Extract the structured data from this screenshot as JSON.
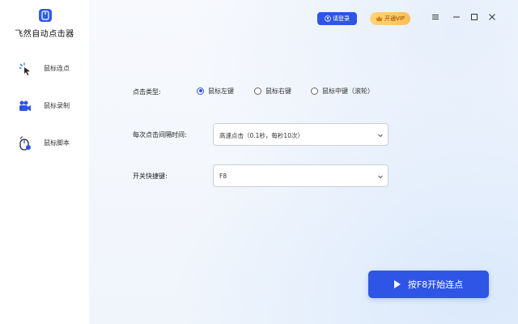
{
  "app": {
    "title": "飞然自动点击器"
  },
  "header": {
    "login_label": "请登录",
    "vip_label": "开通VIP",
    "window_controls": [
      "menu-icon",
      "minimize-icon",
      "maximize-icon",
      "close-icon"
    ]
  },
  "sidebar": {
    "items": [
      {
        "label": "鼠标连点",
        "icon": "mouse-click-icon"
      },
      {
        "label": "鼠标录制",
        "icon": "video-camera-icon"
      },
      {
        "label": "鼠标脚本",
        "icon": "mouse-script-icon"
      }
    ]
  },
  "form": {
    "click_type": {
      "label": "点击类型:",
      "options": [
        "鼠标左键",
        "鼠标右键",
        "鼠标中键（滚轮）"
      ],
      "selected": "鼠标左键"
    },
    "interval": {
      "label": "每次点击间隔时间:",
      "value": "高速点击（0.1秒，每秒10次）"
    },
    "hotkey": {
      "label": "开关快捷键:",
      "value": "F8"
    }
  },
  "start_button": {
    "label": "按F8开始连点"
  },
  "colors": {
    "accent": "#2f55e6",
    "vip": "#ffc55f",
    "sidebar_bg": "#ffffff"
  }
}
